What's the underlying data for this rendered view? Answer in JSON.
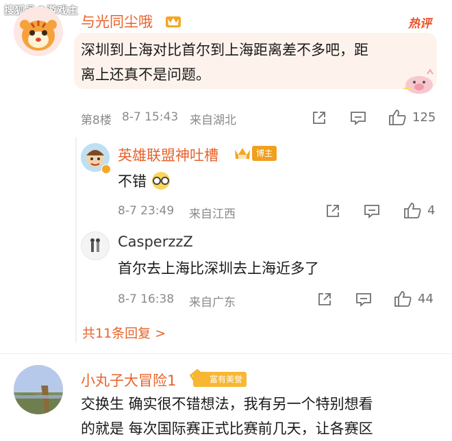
{
  "watermark": "搜狐号@游戏主",
  "comments": [
    {
      "username": "与光同尘哦",
      "hot_label": "热评",
      "text_line1": "深圳到上海对比首尔到上海距离差不多吧，距",
      "text_line2": "离上还真不是问题。",
      "floor": "第8楼",
      "time": "8-7 15:43",
      "location": "来自湖北",
      "likes": "125"
    }
  ],
  "replies": [
    {
      "username": "英雄联盟神吐槽",
      "badge": "博主",
      "text": "不错",
      "time": "8-7 23:49",
      "location": "来自江西",
      "likes": "4"
    },
    {
      "username": "CasperzzZ",
      "text": "首尔去上海比深圳去上海近多了",
      "time": "8-7 16:38",
      "location": "来自广东",
      "likes": "44"
    }
  ],
  "more_replies": "共11条回复 >",
  "next_comment": {
    "username": "小丸子大冒险1",
    "fortune_badge": "富有美誉",
    "text_line1": "交换生 确实很不错想法，我有另一个特别想看",
    "text_line2": "的就是 每次国际赛正式比赛前几天，让各赛区"
  },
  "icons": [
    "share-icon",
    "comment-icon",
    "like-icon",
    "crown-icon",
    "sticker-icon"
  ],
  "colors": {
    "accent": "#e9622a",
    "meta": "#8a8a8a",
    "bubble": "#fdf3ec"
  }
}
